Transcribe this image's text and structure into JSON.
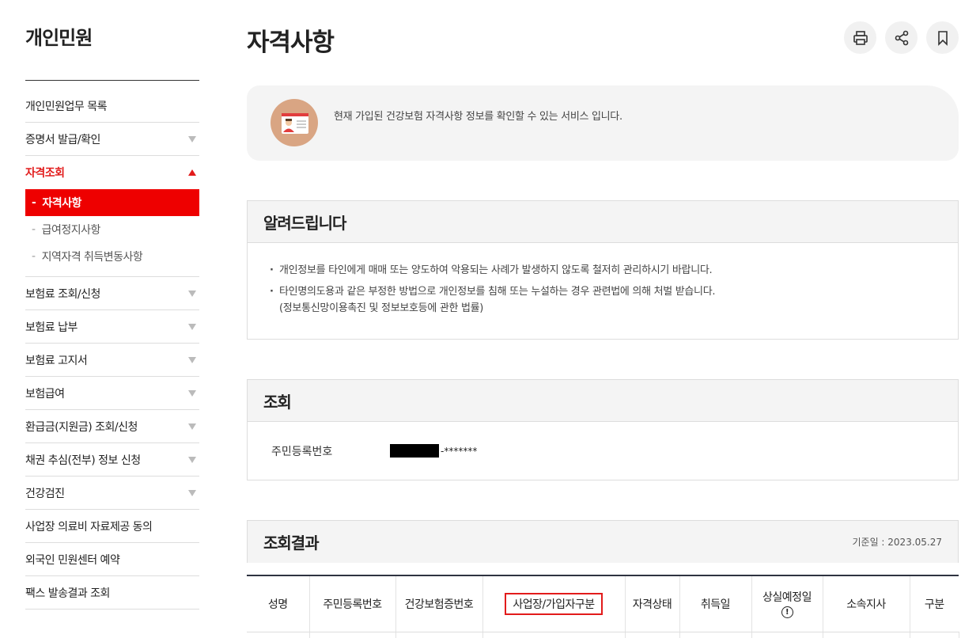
{
  "sidebar": {
    "title": "개인민원",
    "items": [
      {
        "label": "개인민원업무 목록",
        "arrow": false
      },
      {
        "label": "증명서 발급/확인",
        "arrow": true
      },
      {
        "label": "자격조회",
        "arrow": true,
        "active": true
      },
      {
        "label": "보험료 조회/신청",
        "arrow": true
      },
      {
        "label": "보험료 납부",
        "arrow": true
      },
      {
        "label": "보험료 고지서",
        "arrow": true
      },
      {
        "label": "보험급여",
        "arrow": true
      },
      {
        "label": "환급금(지원금) 조회/신청",
        "arrow": true
      },
      {
        "label": "채권 추심(전부) 정보 신청",
        "arrow": true
      },
      {
        "label": "건강검진",
        "arrow": true
      },
      {
        "label": "사업장 의료비 자료제공 동의",
        "arrow": false
      },
      {
        "label": "외국인 민원센터 예약",
        "arrow": false
      },
      {
        "label": "팩스 발송결과 조회",
        "arrow": false
      }
    ],
    "submenu": [
      {
        "dash": "-",
        "label": "자격사항",
        "current": true
      },
      {
        "dash": "-",
        "label": "급여정지사항"
      },
      {
        "dash": "-",
        "label": "지역자격 취득변동사항"
      }
    ]
  },
  "page": {
    "title": "자격사항",
    "intro": "현재 가입된 건강보험 자격사항 정보를 확인할 수 있는 서비스 입니다."
  },
  "toolbar": {
    "print_icon": "print-icon",
    "share_icon": "share-icon",
    "bookmark_icon": "bookmark-icon"
  },
  "notice": {
    "title": "알려드립니다",
    "line1": "개인정보를 타인에게 매매 또는 양도하여 악용되는 사례가 발생하지 않도록 철저히 관리하시기 바랍니다.",
    "line2": "타인명의도용과 같은 부정한 방법으로 개인정보를 침해 또는 누설하는 경우 관련법에 의해 처벌 받습니다.",
    "line2b": "(정보통신망이용촉진 및 정보보호등에 관한 법률)"
  },
  "query": {
    "title": "조회",
    "label": "주민등록번호",
    "masked_suffix": "-*******"
  },
  "result": {
    "title": "조회결과",
    "base_date": "기준일 : 2023.05.27",
    "columns": [
      "성명",
      "주민등록번호",
      "건강보험증번호",
      "사업장/가입자구분",
      "자격상태",
      "취득일",
      "상실예정일",
      "소속지사",
      "구분"
    ],
    "highlight_column": "사업장/가입자구분",
    "accent": "#e21b1b"
  }
}
